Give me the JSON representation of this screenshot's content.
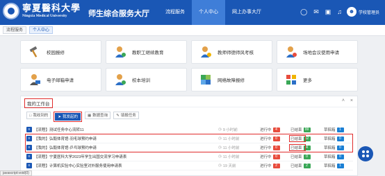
{
  "header": {
    "logo_cn": "寧夏醫科大學",
    "logo_en": "Ningxia Medical University",
    "system_title": "师生综合服务大厅",
    "nav": [
      "流程服务",
      "个人中心",
      "网上办事大厅"
    ],
    "nav_active": 1,
    "user_name": "学校管理员",
    "accent": "#1a57b5"
  },
  "tabs": [
    "流程服务",
    "个人中心"
  ],
  "tabs_active": 1,
  "services": [
    {
      "label": "校园报修",
      "icon": "hammer-icon"
    },
    {
      "label": "教职工继续教育",
      "icon": "person-badge-icon"
    },
    {
      "label": "教师师德师风考核",
      "icon": "person-badge-icon"
    },
    {
      "label": "场地会议使用申请",
      "icon": "person-badge-icon"
    },
    {
      "label": "电子邮箱申请",
      "icon": "email-icon"
    },
    {
      "label": "校本培训",
      "icon": "person-badge-icon"
    },
    {
      "label": "网络故障报修",
      "icon": "puzzle-icon"
    },
    {
      "label": "更多",
      "icon": "grid-icon"
    }
  ],
  "workbench": {
    "title": "我的工作台",
    "tabs": [
      "我收到的",
      "我发起的",
      "数据查询",
      "填报任务"
    ],
    "active_tab": 1,
    "rows": [
      {
        "tag": "【流程】",
        "title": "测试任务中心流转11",
        "time": "9 小时前",
        "jxz_label": "进行中",
        "jxz": "4",
        "yjs_label": "已结束",
        "yjs": "99",
        "cg_label": "草稿箱",
        "cg": "1"
      },
      {
        "tag": "【我的】",
        "title": "弘毅体育馆-羽毛球预约申请",
        "time": "11 小时前",
        "jxz_label": "进行中",
        "jxz": "0",
        "yjs_label": "已结束",
        "yjs": "12",
        "cg_label": "草稿箱",
        "cg": "0"
      },
      {
        "tag": "【我的】",
        "title": "弘毅体育馆-乒乓球预约申请",
        "time": "11 小时前",
        "jxz_label": "进行中",
        "jxz": "0",
        "yjs_label": "已结束",
        "yjs": "4",
        "cg_label": "草稿箱",
        "cg": "0"
      },
      {
        "tag": "【流程】",
        "title": "宁夏医科大学2023年学生出国交流学习申请表",
        "time": "11 小时前",
        "jxz_label": "进行中",
        "jxz": "0",
        "yjs_label": "已结束",
        "yjs": "0",
        "cg_label": "草稿箱",
        "cg": "0"
      },
      {
        "tag": "【流程】",
        "title": "计算机实验中心实验室对外服务使用申请表",
        "time": "19 天前",
        "jxz_label": "进行中",
        "jxz": "2",
        "yjs_label": "已结束",
        "yjs": "2",
        "cg_label": "草稿箱",
        "cg": "1"
      }
    ]
  },
  "status_bar": "javascript:void(0)"
}
